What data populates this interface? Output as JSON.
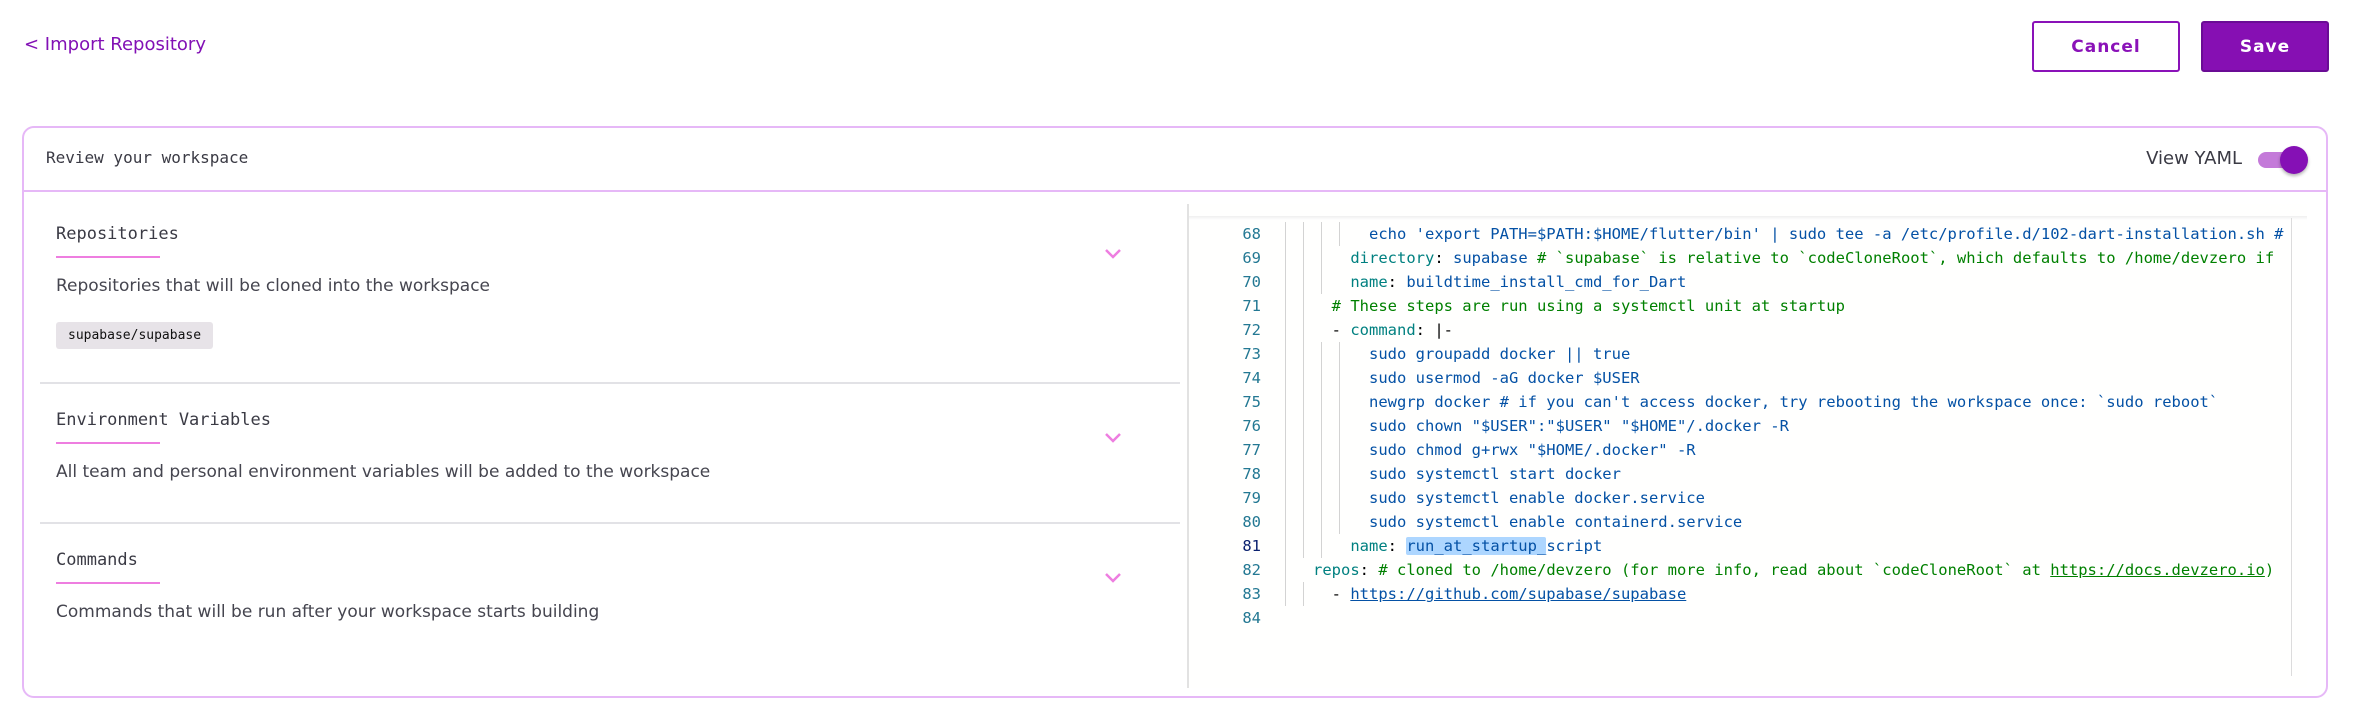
{
  "header": {
    "back_label": "< Import Repository",
    "cancel_label": "Cancel",
    "save_label": "Save"
  },
  "colors": {
    "brand": "#860fb3",
    "accent_underline": "#ee7ee0",
    "card_border": "#e6b8f7"
  },
  "card": {
    "title": "Review your workspace",
    "view_yaml_label": "View YAML",
    "view_yaml_enabled": true
  },
  "sections": [
    {
      "title": "Repositories",
      "description": "Repositories that will be cloned into the workspace",
      "chips": [
        "supabase/supabase"
      ],
      "icon": "chevron-down-icon"
    },
    {
      "title": "Environment Variables",
      "description": "All team and personal environment variables will be added to the workspace",
      "icon": "chevron-down-icon"
    },
    {
      "title": "Commands",
      "description": "Commands that will be run after your workspace starts building",
      "icon": "chevron-down-icon"
    }
  ],
  "editor": {
    "active_line": 81,
    "selection": "run_at_startup_",
    "lines": [
      {
        "n": "68",
        "tokens": [
          {
            "t": "      echo 'export PATH=$PATH:$HOME/flutter/bin' | sudo tee -a /etc/profile.d/102-dart-installation.sh #",
            "c": "s"
          }
        ]
      },
      {
        "n": "69",
        "tokens": [
          {
            "t": "    directory",
            "c": "k"
          },
          {
            "t": ": ",
            "c": "p"
          },
          {
            "t": "supabase ",
            "c": "s"
          },
          {
            "t": "# `supabase` is relative to `codeCloneRoot`, which defaults to /home/devzero if",
            "c": "c"
          }
        ]
      },
      {
        "n": "70",
        "tokens": [
          {
            "t": "    name",
            "c": "k"
          },
          {
            "t": ": ",
            "c": "p"
          },
          {
            "t": "buildtime_install_cmd_for_Dart",
            "c": "s"
          }
        ]
      },
      {
        "n": "71",
        "tokens": [
          {
            "t": "  # These steps are run using a systemctl unit at startup",
            "c": "c"
          }
        ]
      },
      {
        "n": "72",
        "tokens": [
          {
            "t": "  - ",
            "c": "p"
          },
          {
            "t": "command",
            "c": "k"
          },
          {
            "t": ": |-",
            "c": "p"
          }
        ]
      },
      {
        "n": "73",
        "tokens": [
          {
            "t": "      sudo groupadd docker || true",
            "c": "s"
          }
        ]
      },
      {
        "n": "74",
        "tokens": [
          {
            "t": "      sudo usermod -aG docker $USER",
            "c": "s"
          }
        ]
      },
      {
        "n": "75",
        "tokens": [
          {
            "t": "      newgrp docker # if you can't access docker, try rebooting the workspace once: `sudo reboot`",
            "c": "s"
          }
        ]
      },
      {
        "n": "76",
        "tokens": [
          {
            "t": "      sudo chown \"$USER\":\"$USER\" \"$HOME\"/.docker -R",
            "c": "s"
          }
        ]
      },
      {
        "n": "77",
        "tokens": [
          {
            "t": "      sudo chmod g+rwx \"$HOME/.docker\" -R",
            "c": "s"
          }
        ]
      },
      {
        "n": "78",
        "tokens": [
          {
            "t": "      sudo systemctl start docker",
            "c": "s"
          }
        ]
      },
      {
        "n": "79",
        "tokens": [
          {
            "t": "      sudo systemctl enable docker.service",
            "c": "s"
          }
        ]
      },
      {
        "n": "80",
        "tokens": [
          {
            "t": "      sudo systemctl enable containerd.service",
            "c": "s"
          }
        ]
      },
      {
        "n": "81",
        "tokens": [
          {
            "t": "    name",
            "c": "k"
          },
          {
            "t": ": ",
            "c": "p"
          },
          {
            "t": "run_at_startup_",
            "c": "s hl"
          },
          {
            "t": "script",
            "c": "s"
          }
        ]
      },
      {
        "n": "82",
        "tokens": [
          {
            "t": "repos",
            "c": "k"
          },
          {
            "t": ": ",
            "c": "p"
          },
          {
            "t": "# cloned to /home/devzero (for more info, read about `codeCloneRoot` at ",
            "c": "c"
          },
          {
            "t": "https://docs.devzero.io",
            "c": "c lnk"
          },
          {
            "t": ")",
            "c": "c"
          }
        ]
      },
      {
        "n": "83",
        "tokens": [
          {
            "t": "  - ",
            "c": "p"
          },
          {
            "t": "https://github.com/supabase/supabase",
            "c": "s lnk"
          }
        ]
      },
      {
        "n": "84",
        "tokens": []
      }
    ]
  }
}
